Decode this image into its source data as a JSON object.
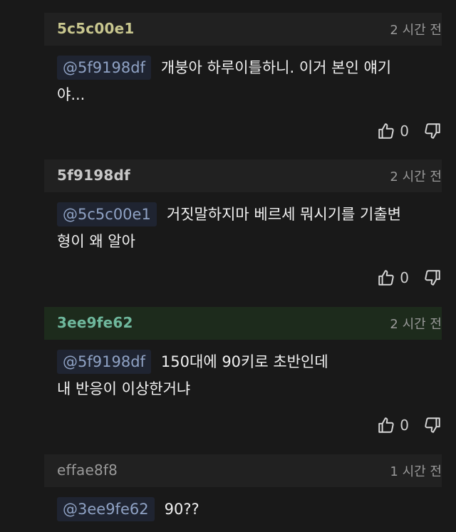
{
  "comments": [
    {
      "author": "5c5c00e1",
      "author_color": "#c9c78f",
      "time": "2 시간 전",
      "mention": "@5f9198df",
      "text1": "개붕아 하루이틀하니. 이거 본인 얘기",
      "text2": "야...",
      "likes": "0"
    },
    {
      "author": "5f9198df",
      "author_color": "#c7c7c7",
      "time": "2 시간 전",
      "mention": "@5c5c00e1",
      "text1": "거짓말하지마 베르세 뭐시기를 기출변",
      "text2": "형이 왜 알아",
      "likes": "0"
    },
    {
      "author": "3ee9fe62",
      "author_color": "#6fb89d",
      "time": "2 시간 전",
      "mention": "@5f9198df",
      "text1": "150대에 90키로 초반인데",
      "text2": "내 반응이 이상한거냐",
      "likes": "0"
    },
    {
      "author": "effae8f8",
      "author_color": "#9a9a9a",
      "time": "1 시간 전",
      "mention": "@3ee9fe62",
      "text1": "90??",
      "text2": "",
      "likes": ""
    }
  ],
  "icons": {
    "like": "thumbs-up-icon",
    "dislike": "thumbs-down-icon"
  }
}
